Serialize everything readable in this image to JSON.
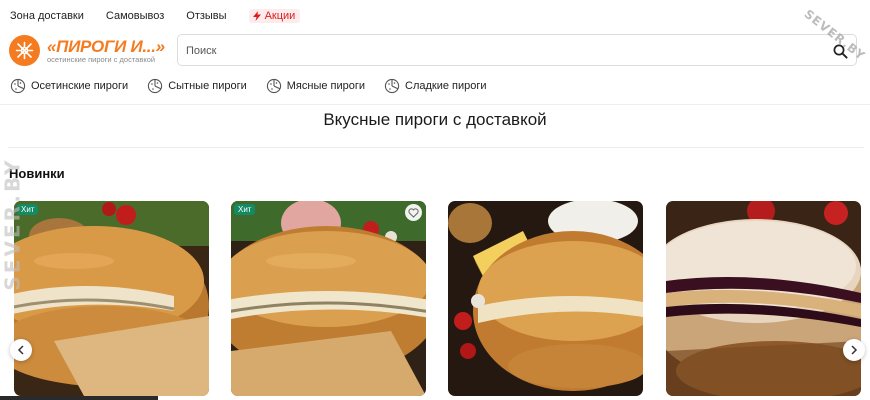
{
  "topnav": {
    "links": [
      "Зона доставки",
      "Самовывоз",
      "Отзывы"
    ],
    "promo_label": "Акции",
    "promo_color": "#d81e1e"
  },
  "logo": {
    "title": "«ПИРОГИ И...»",
    "subtitle": "осетинские пироги с доставкой",
    "brand_color": "#f47b20"
  },
  "search": {
    "placeholder": "Поиск",
    "value": ""
  },
  "categories": [
    {
      "label": "Осетинские пироги",
      "icon": "pie-icon"
    },
    {
      "label": "Сытные пироги",
      "icon": "pie-icon"
    },
    {
      "label": "Мясные пироги",
      "icon": "pie-icon"
    },
    {
      "label": "Сладкие пироги",
      "icon": "pie-icon"
    }
  ],
  "main": {
    "title": "Вкусные пироги с доставкой",
    "section_title": "Новинки"
  },
  "products": [
    {
      "badge": "Хит",
      "fav": false,
      "image": "cheese-pie-photo"
    },
    {
      "badge": "Хит",
      "fav": true,
      "image": "meat-pie-photo"
    },
    {
      "badge": "",
      "fav": false,
      "image": "potato-cheese-pie-photo"
    },
    {
      "badge": "",
      "fav": false,
      "image": "berry-pie-photo"
    }
  ],
  "accent_colors": {
    "hit_badge": "#148a64",
    "title_text": "#1a1a1a"
  },
  "watermark": {
    "left_text": "SEVER.BY",
    "right_text": "SEVER.BY"
  }
}
